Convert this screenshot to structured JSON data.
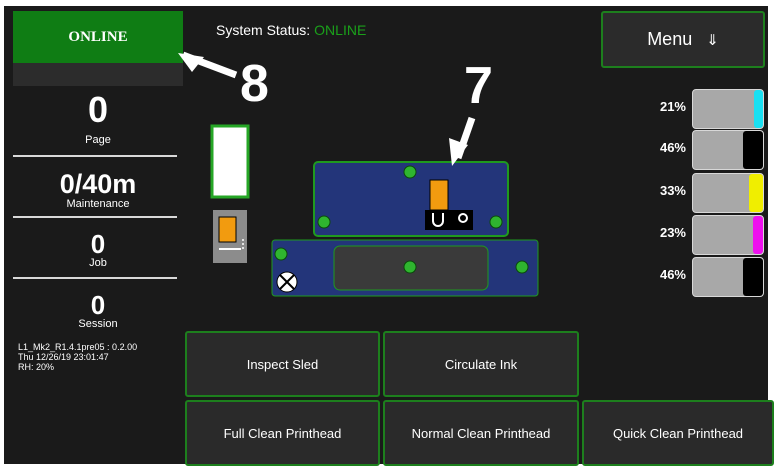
{
  "status": {
    "label": "ONLINE"
  },
  "system_status": {
    "label": "System Status:",
    "value": "ONLINE"
  },
  "counters": [
    {
      "value": "0",
      "label": "Page"
    },
    {
      "value": "0/40m",
      "label": "Maintenance"
    },
    {
      "value": "0",
      "label": "Job"
    },
    {
      "value": "0",
      "label": "Session"
    }
  ],
  "info": {
    "line1": "L1_Mk2_R1.4.1pre05 : 0.2.00",
    "line2": "Thu 12/26/19 23:01:47",
    "line3": "RH: 20%"
  },
  "menu": {
    "label": "Menu",
    "icon": "arrow-down-icon"
  },
  "inks": [
    {
      "percent": "21%",
      "level": 0.21,
      "color": "#19e0f2"
    },
    {
      "percent": "46%",
      "level": 0.46,
      "color": "#000000"
    },
    {
      "percent": "33%",
      "level": 0.33,
      "color": "#f0ee00"
    },
    {
      "percent": "23%",
      "level": 0.23,
      "color": "#ee10ee"
    },
    {
      "percent": "46%",
      "level": 0.46,
      "color": "#000000"
    }
  ],
  "buttons": {
    "inspect_sled": "Inspect Sled",
    "circulate_ink": "Circulate Ink",
    "full_clean": "Full Clean Printhead",
    "normal_clean": "Normal Clean Printhead",
    "quick_clean": "Quick Clean Printhead"
  },
  "annotations": {
    "a8": "8",
    "a7": "7"
  },
  "colors": {
    "online_green": "#0f7d14",
    "border_green": "#1d7f1d",
    "sled_blue": "#23357a"
  }
}
